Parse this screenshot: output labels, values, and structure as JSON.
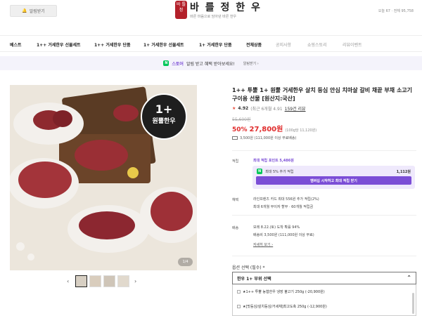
{
  "header": {
    "notify_label": "알림받기",
    "seal_text": "바 틀 정",
    "brand_title": "바 를 정 한 우",
    "brand_tagline": "바른 마음으로 담아낸 바른 한우",
    "visitors": "오늘 67 · 전체 95,758"
  },
  "nav": {
    "items": [
      "베스트",
      "1++ 거세한우 선물세트",
      "1++ 거세한우 단품",
      "1+ 거세한우 선물세트",
      "1+ 거세한우 단품",
      "전체상품",
      "공지사항",
      "쇼핑스토리",
      "리뷰이벤트"
    ]
  },
  "banner": {
    "n_badge": "N",
    "store_label": "스토어",
    "text": "알림 받고 혜택 받아보세요!",
    "link_label": "알림받기 ›"
  },
  "image": {
    "badge_top": "1+",
    "badge_bottom": "원뿔한우",
    "counter": "1/4"
  },
  "product": {
    "title": "1++ 투뿔 1+ 원뿔 거세한우 살치 등심 안심 치마살 갈비 채끝 부채 소고기 구이용 선물 [원산지:국산]",
    "rating": "4.92",
    "rating_note": "(최근 6개월 4.91",
    "review_link": "159건 리뷰",
    "original_price": "55,600원",
    "discount": "50%",
    "price": "27,800원",
    "unit_price": "(100g당 11,120원)",
    "shipping": "3,500원 (111,000원 이상 무료배송)"
  },
  "benefits": {
    "label": "적립",
    "max_points": "최대 적립 포인트 5,486원",
    "row_badge": "N",
    "row_text": "최대 5% 추가 적립",
    "row_amount": "1,112원",
    "button_label": "멤버십 시작하고 최대 적립 받기"
  },
  "card": {
    "label": "혜택",
    "line1": "라인프렌즈 카드 최대 556원 추가 적립(2%)",
    "line2": "최대 6개월 무이자 할부 · 60개월 적립금 "
  },
  "delivery": {
    "label": "배송",
    "line1": "모레 8.22.(토) 도착 확률 94%",
    "line2": "배송비 3,500원 (111,000원 이상 무료)",
    "more": "자세히 보기 ›"
  },
  "options": {
    "label": "옵션 선택 (필수) *",
    "selected": "한우 1+ 부위 선택",
    "items": [
      "★1++ 투뿔 농협한우 냉장 불고기 250g (-20,900원)",
      "★[맛등심/살치등심/거세채]최고도축 250g (-12,900원)"
    ]
  }
}
